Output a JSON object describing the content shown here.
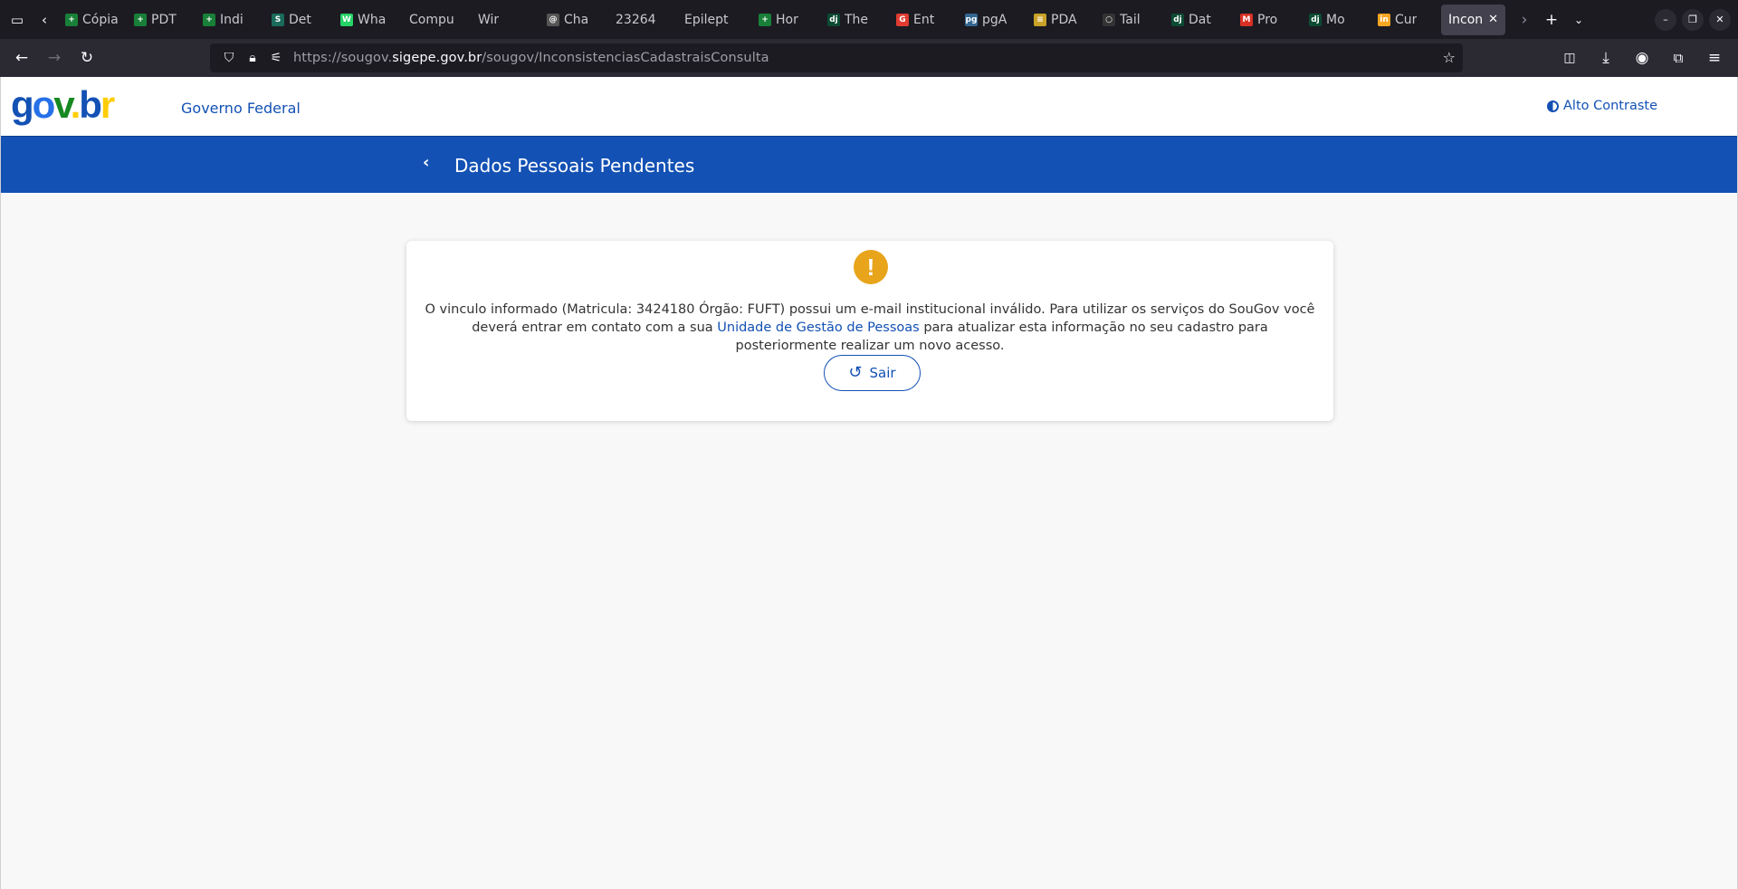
{
  "browser": {
    "tabs": [
      {
        "title": "Cópia",
        "favicon_color": "#188038",
        "favicon_glyph": "+"
      },
      {
        "title": "PDT",
        "favicon_color": "#188038",
        "favicon_glyph": "+"
      },
      {
        "title": "Indi",
        "favicon_color": "#188038",
        "favicon_glyph": "+"
      },
      {
        "title": "Det",
        "favicon_color": "#1a6b5b",
        "favicon_glyph": "S"
      },
      {
        "title": "Wha",
        "favicon_color": "#25d366",
        "favicon_glyph": "W"
      },
      {
        "title": "Compu",
        "favicon_color": "",
        "favicon_glyph": ""
      },
      {
        "title": "Wir",
        "favicon_color": "",
        "favicon_glyph": ""
      },
      {
        "title": "Cha",
        "favicon_color": "#555555",
        "favicon_glyph": "@"
      },
      {
        "title": "23264",
        "favicon_color": "",
        "favicon_glyph": ""
      },
      {
        "title": "Epilept",
        "favicon_color": "",
        "favicon_glyph": ""
      },
      {
        "title": "Hor",
        "favicon_color": "#188038",
        "favicon_glyph": "+"
      },
      {
        "title": "The",
        "favicon_color": "#0c4b33",
        "favicon_glyph": "dj"
      },
      {
        "title": "Ent",
        "favicon_color": "#e03c31",
        "favicon_glyph": "G"
      },
      {
        "title": "pgA",
        "favicon_color": "#336791",
        "favicon_glyph": "pg"
      },
      {
        "title": "PDA",
        "favicon_color": "#c9a227",
        "favicon_glyph": "≡"
      },
      {
        "title": "Tail",
        "favicon_color": "#333333",
        "favicon_glyph": "○"
      },
      {
        "title": "Dat",
        "favicon_color": "#0c4b33",
        "favicon_glyph": "dj"
      },
      {
        "title": "Pro",
        "favicon_color": "#d93025",
        "favicon_glyph": "M"
      },
      {
        "title": "Mo",
        "favicon_color": "#0c4b33",
        "favicon_glyph": "dj"
      },
      {
        "title": "Cur",
        "favicon_color": "#f5a623",
        "favicon_glyph": "in"
      }
    ],
    "active_tab": {
      "title": "Incon"
    },
    "url": {
      "prefix": "https://sougov.",
      "domain": "sigepe.gov.br",
      "path": "/sougov/InconsistenciasCadastraisConsulta"
    }
  },
  "header": {
    "logo": {
      "g": "g",
      "o": "o",
      "v": "v",
      "dot": ".",
      "b": "b",
      "r": "r"
    },
    "gov_federal": "Governo Federal",
    "contrast": "Alto Contraste"
  },
  "banner": {
    "back": "‹",
    "title": "Dados Pessoais Pendentes"
  },
  "card": {
    "icon": "!",
    "message_part1": "O vinculo informado (Matricula: 3424180 Órgão: FUFT) possui um e-mail institucional inválido. Para utilizar os serviços do SouGov você deverá entrar em contato com a sua ",
    "message_link": "Unidade de Gestão de Pessoas",
    "message_part2": " para atualizar esta informação no seu cadastro para posteriormente realizar um novo acesso.",
    "button_label": "Sair"
  },
  "colors": {
    "primary": "#1351b4",
    "warning": "#e8a41a",
    "background": "#f8f8f8"
  }
}
